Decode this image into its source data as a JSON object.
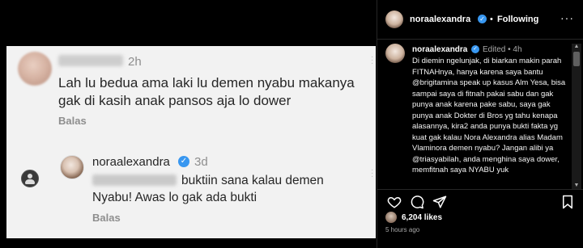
{
  "post_image": {
    "comment1": {
      "time": "2h",
      "text": "Lah lu bedua ama laki lu demen nyabu makanya gak di kasih anak pansos aja lo dower",
      "reply_label": "Balas"
    },
    "comment2": {
      "username": "noraalexandra",
      "time": "3d",
      "text": "buktiin sana kalau demen Nyabu! Awas lo gak ada bukti",
      "reply_label": "Balas"
    }
  },
  "panel": {
    "header": {
      "username": "noraalexandra",
      "separator": "•",
      "follow_label": "Following",
      "more_icon": "more-icon"
    },
    "caption": {
      "username": "noraalexandra",
      "edited": "Edited • 4h",
      "text": "Di diemin ngelunjak, di biarkan makin parah FITNAHnya, hanya karena saya bantu @brigitamina speak up kasus Alm Yesa, bisa sampai saya di fitnah pakai sabu dan gak punya anak karena pake sabu, saya gak punya anak Dokter di Bros yg tahu kenapa alasannya, kira2 anda punya bukti fakta yg kuat gak kalau Nora Alexandra alias Madam Vlaminora demen nyabu? Jangan alibi ya @triasyabilah, anda menghina saya dower, memfitnah saya NYABU yuk"
    },
    "likes": "6,204 likes",
    "time_ago": "5 hours ago",
    "colors": {
      "verified": "#3897f0",
      "background": "#000000",
      "comment_bg": "#f2f2f2"
    }
  }
}
